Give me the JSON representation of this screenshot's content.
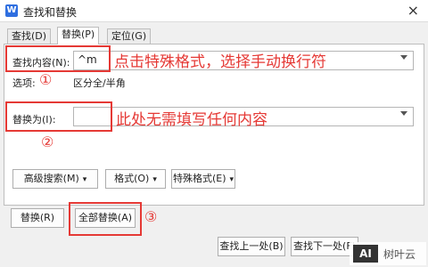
{
  "window": {
    "title": "查找和替换",
    "app_icon": "W",
    "close_glyph": "×"
  },
  "tabs": [
    {
      "label": "查找(D)",
      "active": false
    },
    {
      "label": "替换(P)",
      "active": true
    },
    {
      "label": "定位(G)",
      "active": false
    }
  ],
  "find": {
    "label": "查找内容(N):",
    "value": "^m",
    "options_label": "选项:",
    "options_value": "区分全/半角"
  },
  "replace": {
    "label": "替换为(I):",
    "value": ""
  },
  "annotations": {
    "find_hint": "点击特殊格式，选择手动换行符",
    "replace_hint": "此处无需填写任何内容",
    "step1": "①",
    "step2": "②",
    "step3": "③"
  },
  "buttons": {
    "advanced": "高级搜索(M)",
    "format": "格式(O)",
    "special": "特殊格式(E)",
    "replace": "替换(R)",
    "replace_all": "全部替换(A)",
    "find_prev": "查找上一处(B)",
    "find_next": "查找下一处(F)"
  },
  "watermark": {
    "logo": "AI",
    "text": "树叶云"
  },
  "colors": {
    "annotation": "#e53935",
    "accent": "#2f6fe0"
  }
}
